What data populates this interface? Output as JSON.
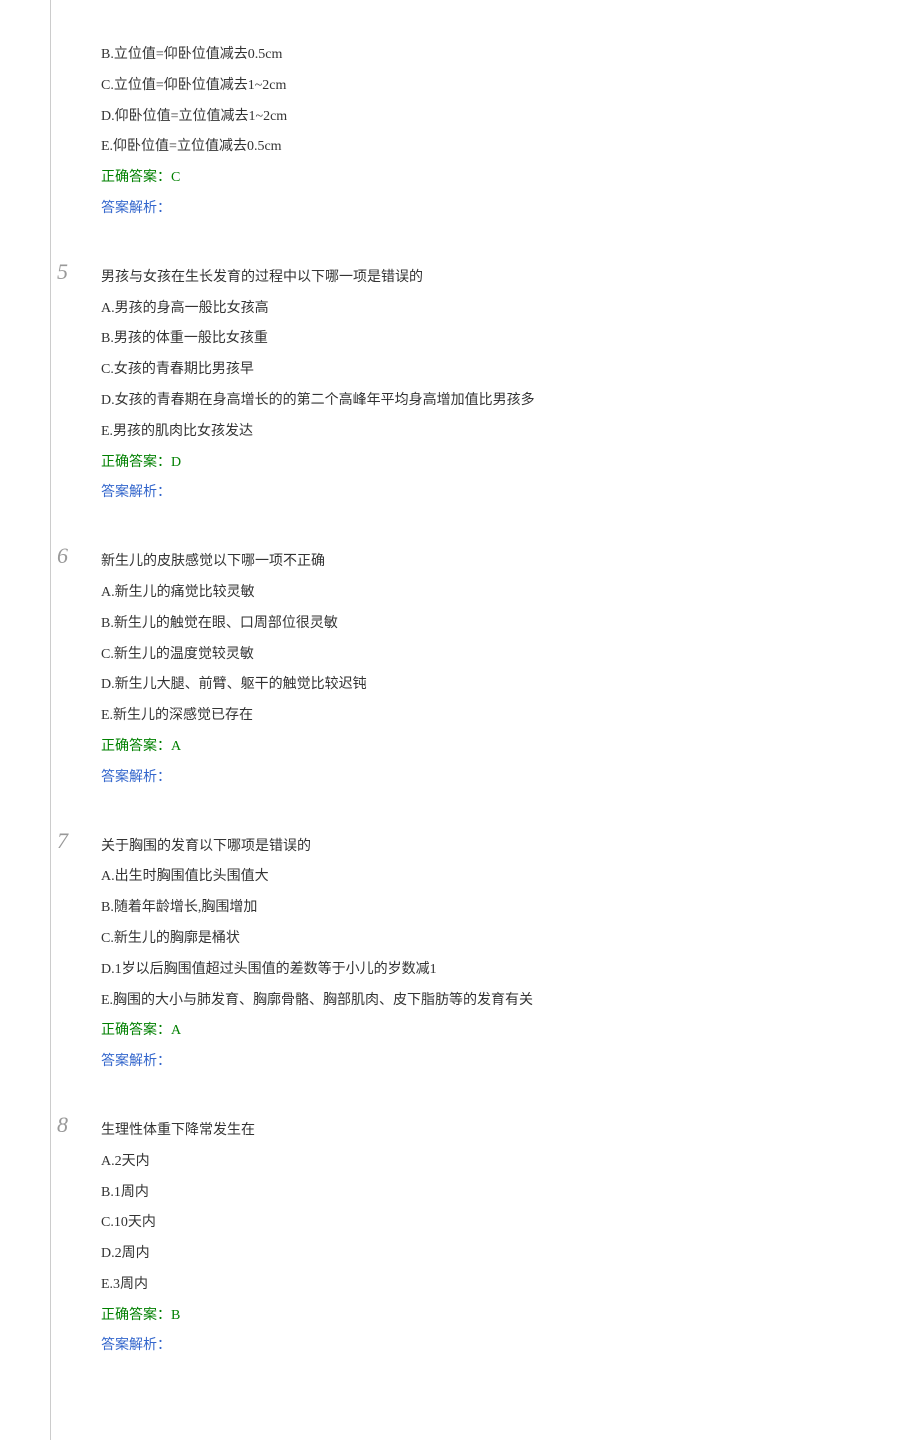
{
  "labels": {
    "correct_prefix": "正确答案：",
    "analysis_label": "答案解析："
  },
  "q4_tail": {
    "options": [
      "B.立位值=仰卧位值减去0.5cm",
      "C.立位值=仰卧位值减去1~2cm",
      "D.仰卧位值=立位值减去1~2cm",
      "E.仰卧位值=立位值减去0.5cm"
    ],
    "correct": "C"
  },
  "questions": [
    {
      "number": "5",
      "stem": "男孩与女孩在生长发育的过程中以下哪一项是错误的",
      "options": [
        "A.男孩的身高一般比女孩高",
        "B.男孩的体重一般比女孩重",
        "C.女孩的青春期比男孩早",
        "D.女孩的青春期在身高增长的的第二个高峰年平均身高增加值比男孩多",
        "E.男孩的肌肉比女孩发达"
      ],
      "correct": "D"
    },
    {
      "number": "6",
      "stem": "新生儿的皮肤感觉以下哪一项不正确",
      "options": [
        "A.新生儿的痛觉比较灵敏",
        "B.新生儿的触觉在眼、口周部位很灵敏",
        "C.新生儿的温度觉较灵敏",
        "D.新生儿大腿、前臂、躯干的触觉比较迟钝",
        "E.新生儿的深感觉已存在"
      ],
      "correct": "A"
    },
    {
      "number": "7",
      "stem": "关于胸围的发育以下哪项是错误的",
      "options": [
        "A.出生时胸围值比头围值大",
        "B.随着年龄增长,胸围增加",
        "C.新生儿的胸廓是桶状",
        "D.1岁以后胸围值超过头围值的差数等于小儿的岁数减1",
        "E.胸围的大小与肺发育、胸廓骨骼、胸部肌肉、皮下脂肪等的发育有关"
      ],
      "correct": "A"
    },
    {
      "number": "8",
      "stem": "生理性体重下降常发生在",
      "options": [
        "A.2天内",
        "B.1周内",
        "C.10天内",
        "D.2周内",
        "E.3周内"
      ],
      "correct": "B"
    }
  ]
}
